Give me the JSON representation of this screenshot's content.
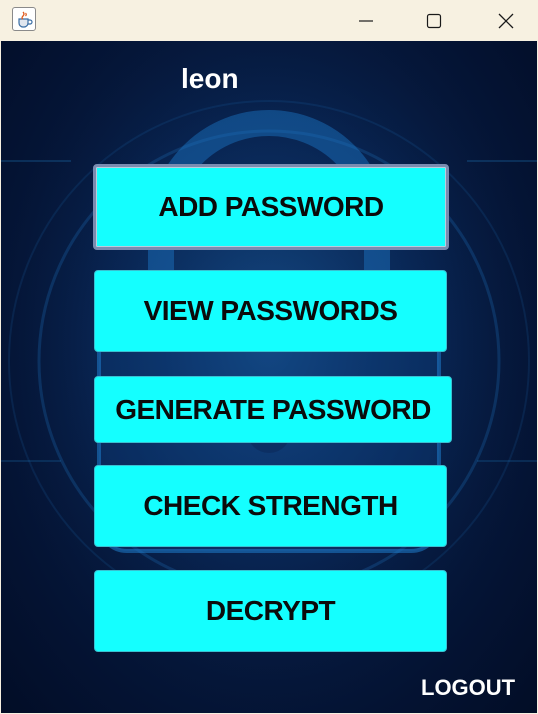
{
  "window": {
    "app_icon": "java-cup-icon",
    "controls": {
      "minimize": "minimize-icon",
      "maximize": "maximize-icon",
      "close": "close-icon"
    }
  },
  "user": {
    "name": "leon"
  },
  "menu": {
    "add_password": "ADD PASSWORD",
    "view_passwords": "VIEW PASSWORDS",
    "generate_password": "GENERATE PASSWORD",
    "check_strength": "CHECK STRENGTH",
    "decrypt": "DECRYPT"
  },
  "logout_label": "LOGOUT",
  "colors": {
    "button_bg": "#14ffff",
    "background": "#061a40",
    "titlebar": "#f7f1e1",
    "text_light": "#ffffff"
  }
}
